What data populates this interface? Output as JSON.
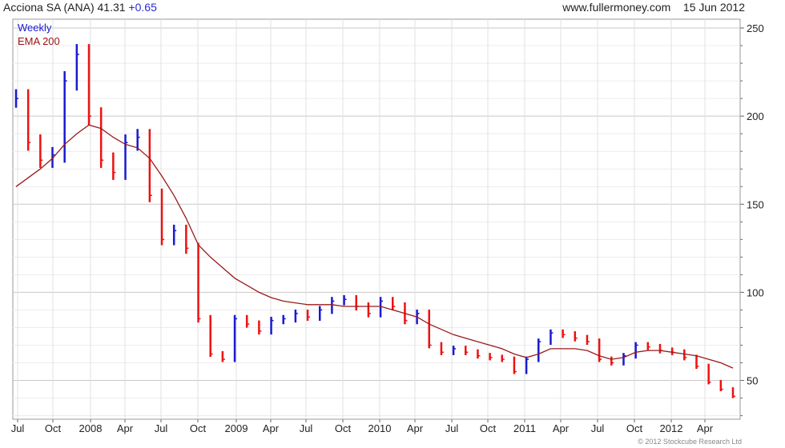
{
  "header": {
    "symbol": "Acciona SA (ANA)",
    "price": "41.31",
    "change": "+0.65",
    "website": "www.fullermoney.com",
    "date": "15 Jun 2012"
  },
  "copyright": "© 2012 Stockcube Research Ltd",
  "colors": {
    "up": "#1a1ad0",
    "down": "#ee1111",
    "ema": "#9a1a1a",
    "grid": "#d9d9d9"
  },
  "chart_data": {
    "type": "line",
    "title": "Acciona SA (ANA)",
    "legend": [
      "Weekly",
      "EMA 200"
    ],
    "ylim": [
      28,
      255
    ],
    "x_ticks": [
      "Jul",
      "Oct",
      "2008",
      "Apr",
      "Jul",
      "Oct",
      "2009",
      "Apr",
      "Jul",
      "Oct",
      "2010",
      "Apr",
      "Jul",
      "Oct",
      "2011",
      "Apr",
      "Jul",
      "Oct",
      "2012",
      "Apr"
    ],
    "y_ticks": [
      50,
      100,
      150,
      200,
      250
    ],
    "x": [
      "Jul 2007",
      "Aug 2007",
      "Sep 2007",
      "Oct 2007",
      "Nov 2007",
      "Dec 2007",
      "Jan 2008",
      "Feb 2008",
      "Mar 2008",
      "Apr 2008",
      "May 2008",
      "Jun 2008",
      "Jul 2008",
      "Aug 2008",
      "Sep 2008",
      "Oct 2008",
      "Nov 2008",
      "Dec 2008",
      "Jan 2009",
      "Feb 2009",
      "Mar 2009",
      "Apr 2009",
      "May 2009",
      "Jun 2009",
      "Jul 2009",
      "Aug 2009",
      "Sep 2009",
      "Oct 2009",
      "Nov 2009",
      "Dec 2009",
      "Jan 2010",
      "Feb 2010",
      "Mar 2010",
      "Apr 2010",
      "May 2010",
      "Jun 2010",
      "Jul 2010",
      "Aug 2010",
      "Sep 2010",
      "Oct 2010",
      "Nov 2010",
      "Dec 2010",
      "Jan 2011",
      "Feb 2011",
      "Mar 2011",
      "Apr 2011",
      "May 2011",
      "Jun 2011",
      "Jul 2011",
      "Aug 2011",
      "Sep 2011",
      "Oct 2011",
      "Nov 2011",
      "Dec 2011",
      "Jan 2012",
      "Feb 2012",
      "Mar 2012",
      "Apr 2012",
      "May 2012",
      "Jun 2012"
    ],
    "series": [
      {
        "name": "Weekly",
        "values": [
          210,
          185,
          175,
          178,
          220,
          235,
          200,
          175,
          168,
          185,
          188,
          155,
          130,
          135,
          125,
          85,
          65,
          62,
          85,
          82,
          78,
          84,
          85,
          88,
          86,
          90,
          95,
          96,
          92,
          88,
          95,
          92,
          84,
          88,
          70,
          66,
          68,
          66,
          64,
          63,
          62,
          55,
          62,
          72,
          77,
          76,
          74,
          72,
          62,
          60,
          64,
          70,
          69,
          67,
          66,
          63,
          58,
          49,
          45,
          41
        ]
      },
      {
        "name": "EMA 200",
        "values": [
          160,
          165,
          170,
          176,
          184,
          190,
          195,
          193,
          188,
          184,
          182,
          176,
          166,
          155,
          142,
          127,
          120,
          114,
          108,
          104,
          100,
          97,
          95,
          94,
          93,
          93,
          93,
          92,
          92,
          92,
          92,
          90,
          88,
          86,
          82,
          79,
          76,
          74,
          72,
          70,
          68,
          65,
          63,
          65,
          68,
          68,
          68,
          67,
          64,
          62,
          63,
          66,
          67,
          67,
          66,
          65,
          64,
          62,
          60,
          57
        ]
      }
    ]
  }
}
